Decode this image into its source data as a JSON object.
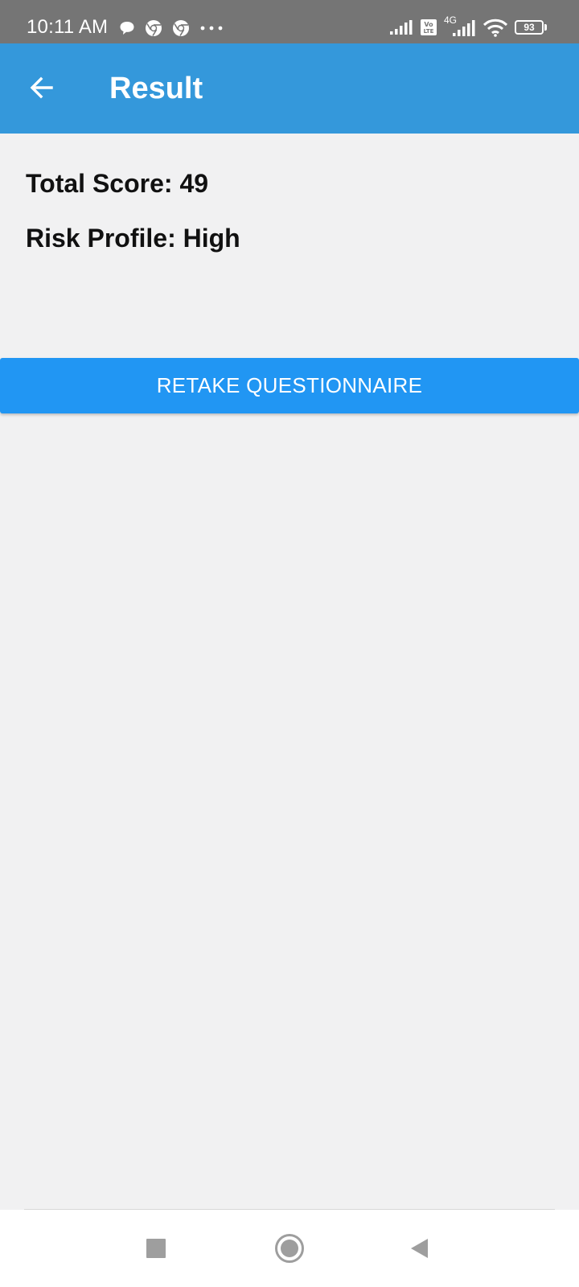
{
  "status_bar": {
    "time": "10:11 AM",
    "icons": [
      "chat-bubble-icon",
      "chrome-icon",
      "chrome-icon",
      "more-dots-icon",
      "signal-icon",
      "volte-icon",
      "4g-signal-icon",
      "wifi-icon",
      "battery-icon"
    ],
    "network_label": "4G",
    "volte_label": "Vo LTE",
    "battery_level": "93"
  },
  "app_bar": {
    "title": "Result",
    "back_icon": "arrow-left-icon",
    "color": "#3498db"
  },
  "result": {
    "total_score_text": "Total Score: 49",
    "risk_profile_text": "Risk Profile: High"
  },
  "actions": {
    "retake_label": "RETAKE QUESTIONNAIRE",
    "button_color": "#2196f3"
  },
  "nav_bar": {
    "icons": [
      "recents-square-icon",
      "home-circle-icon",
      "back-triangle-icon"
    ]
  }
}
